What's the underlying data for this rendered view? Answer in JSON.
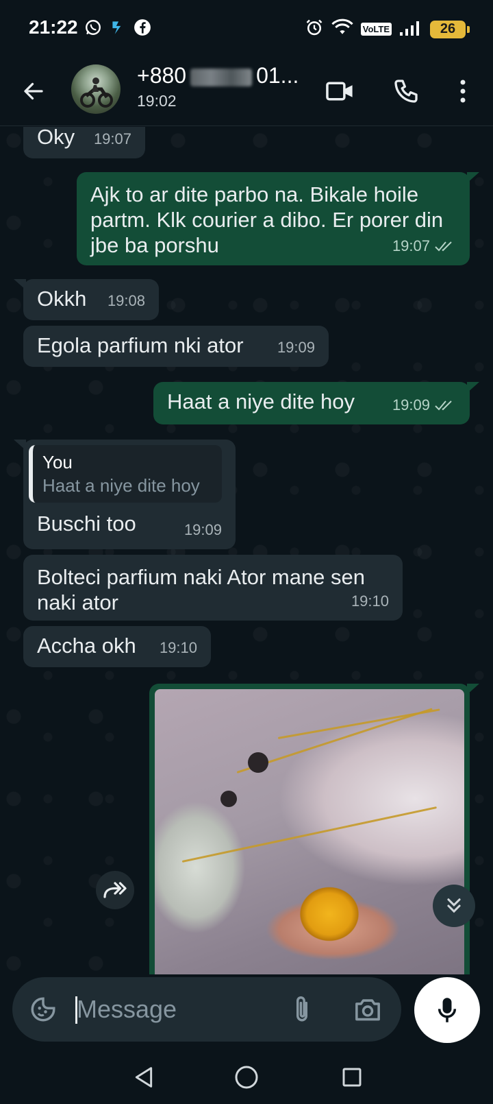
{
  "status_bar": {
    "time": "21:22",
    "volte": "VoLTE",
    "battery": "26"
  },
  "header": {
    "contact_prefix": "+880",
    "contact_suffix": "01...",
    "last_seen": "19:02"
  },
  "messages": [
    {
      "dir": "in",
      "text": "Oky",
      "time": "19:07"
    },
    {
      "dir": "out",
      "text": "Ajk to ar dite parbo na. Bikale hoile partm. Klk courier a dibo. Er porer din jbe ba porshu",
      "time": "19:07"
    },
    {
      "dir": "in",
      "text": "Okkh",
      "time": "19:08"
    },
    {
      "dir": "in",
      "text": "Egola parfium nki ator",
      "time": "19:09"
    },
    {
      "dir": "out",
      "text": "Haat a niye dite hoy",
      "time": "19:09"
    },
    {
      "dir": "in",
      "text": "Buschi too",
      "time": "19:09",
      "quote": {
        "author": "You",
        "text": "Haat a niye dite hoy"
      }
    },
    {
      "dir": "in",
      "text": "Bolteci parfium naki Ator mane sen naki ator",
      "time": "19:10"
    },
    {
      "dir": "in",
      "text": "Accha okh",
      "time": "19:10"
    }
  ],
  "composer": {
    "placeholder": "Message"
  },
  "colors": {
    "background": "#0b141a",
    "incoming_bubble": "#202c33",
    "outgoing_bubble": "#134d37",
    "read_tick": "#b6d4c8"
  }
}
